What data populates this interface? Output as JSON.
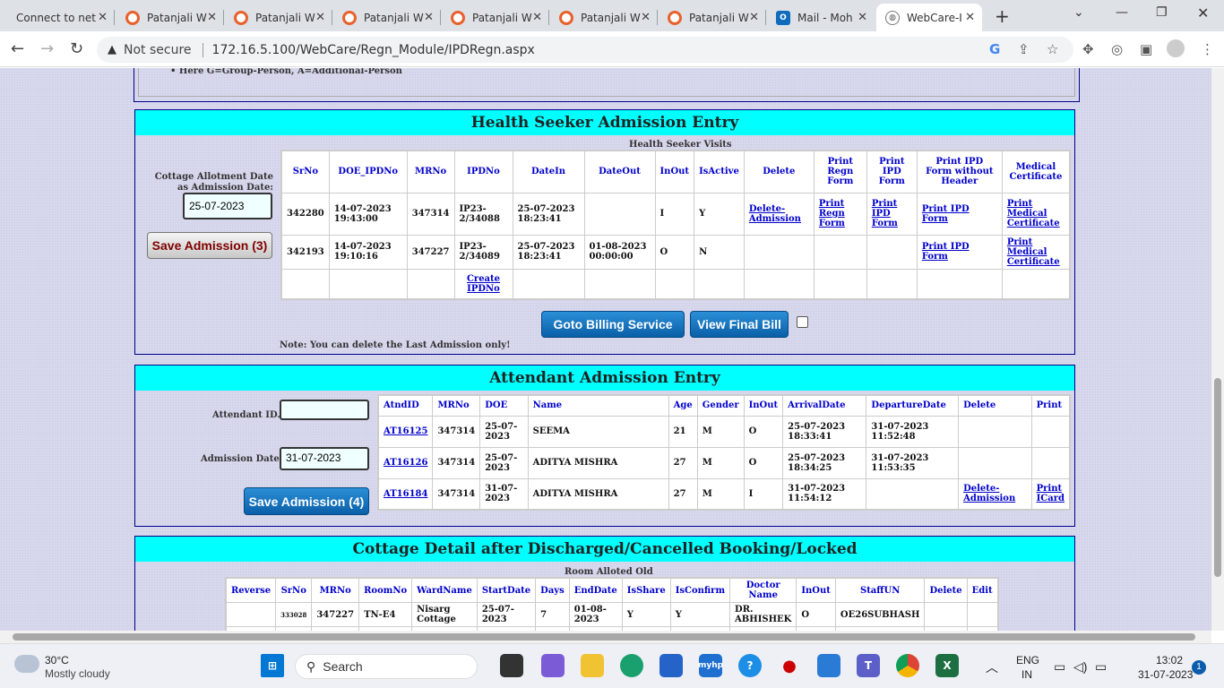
{
  "browser": {
    "tabs": [
      {
        "label": "Connect to net",
        "icon": "none"
      },
      {
        "label": "Patanjali W",
        "icon": "patanjali"
      },
      {
        "label": "Patanjali W",
        "icon": "patanjali"
      },
      {
        "label": "Patanjali W",
        "icon": "patanjali"
      },
      {
        "label": "Patanjali W",
        "icon": "patanjali"
      },
      {
        "label": "Patanjali W",
        "icon": "patanjali"
      },
      {
        "label": "Patanjali W",
        "icon": "patanjali"
      },
      {
        "label": "Mail - Moh",
        "icon": "outlook"
      },
      {
        "label": "WebCare-I",
        "icon": "webcare"
      }
    ],
    "security": "Not secure",
    "url": "172.16.5.100/WebCare/Regn_Module/IPDRegn.aspx"
  },
  "top_note": "Here G=Group-Person, A=Additional-Person",
  "hs": {
    "title": "Health Seeker Admission Entry",
    "caption": "Health Seeker Visits",
    "cottage_label": "Cottage Allotment Date as Admission Date:",
    "date": "25-07-2023",
    "save": "Save Admission (3)",
    "headers": [
      "SrNo",
      "DOE_IPDNo",
      "MRNo",
      "IPDNo",
      "DateIn",
      "DateOut",
      "InOut",
      "IsActive",
      "Delete",
      "Print Regn Form",
      "Print IPD Form",
      "Print IPD Form without Header",
      "Medical Certificate"
    ],
    "rows": [
      [
        "342280",
        "14-07-2023 19:43:00",
        "347314",
        "IP23-2/34088",
        "25-07-2023 18:23:41",
        "",
        "I",
        "Y",
        "Delete-Admission",
        "Print Regn Form",
        "Print IPD Form",
        "Print IPD Form",
        "Print Medical Certificate"
      ],
      [
        "342193",
        "14-07-2023 19:10:16",
        "347227",
        "IP23-2/34089",
        "25-07-2023 18:23:41",
        "01-08-2023 00:00:00",
        "O",
        "N",
        "",
        "",
        "",
        "Print IPD Form",
        "Print Medical Certificate"
      ],
      [
        "",
        "",
        "",
        "Create IPDNo",
        "",
        "",
        "",
        "",
        "",
        "",
        "",
        "",
        ""
      ]
    ],
    "billing": "Goto Billing Service",
    "final_bill": "View Final Bill",
    "note": "Note: You can delete the Last Admission only!"
  },
  "att": {
    "title": "Attendant Admission Entry",
    "id_label": "Attendant ID.",
    "id_value": "",
    "date_label": "Admission Date",
    "date": "31-07-2023",
    "save": "Save Admission (4)",
    "headers": [
      "AtndID",
      "MRNo",
      "DOE",
      "Name",
      "Age",
      "Gender",
      "InOut",
      "ArrivalDate",
      "DepartureDate",
      "Delete",
      "Print"
    ],
    "rows": [
      [
        "AT16125",
        "347314",
        "25-07-2023",
        "SEEMA",
        "21",
        "M",
        "O",
        "25-07-2023 18:33:41",
        "31-07-2023 11:52:48",
        "",
        ""
      ],
      [
        "AT16126",
        "347314",
        "25-07-2023",
        "ADITYA MISHRA",
        "27",
        "M",
        "O",
        "25-07-2023 18:34:25",
        "31-07-2023 11:53:35",
        "",
        ""
      ],
      [
        "AT16184",
        "347314",
        "31-07-2023",
        "ADITYA MISHRA",
        "27",
        "M",
        "I",
        "31-07-2023 11:54:12",
        "",
        "Delete-Admission",
        "Print ICard"
      ]
    ]
  },
  "cot": {
    "title": "Cottage Detail after Discharged/Cancelled Booking/Locked",
    "caption": "Room Alloted Old",
    "headers": [
      "Reverse",
      "SrNo",
      "MRNo",
      "RoomNo",
      "WardName",
      "StartDate",
      "Days",
      "EndDate",
      "IsShare",
      "IsConfirm",
      "Doctor Name",
      "InOut",
      "StaffUN",
      "Delete",
      "Edit"
    ],
    "rows": [
      [
        "",
        "333028",
        "347227",
        "TN-E4",
        "Nisarg Cottage",
        "25-07-2023",
        "7",
        "01-08-2023",
        "Y",
        "Y",
        "DR. ABHISHEK",
        "O",
        "OE26SUBHASH",
        "",
        ""
      ]
    ]
  },
  "taskbar": {
    "temp": "30°C",
    "weather": "Mostly cloudy",
    "search": "Search",
    "lang1": "ENG",
    "lang2": "IN",
    "time": "13:02",
    "date": "31-07-2023",
    "notif": "1"
  }
}
